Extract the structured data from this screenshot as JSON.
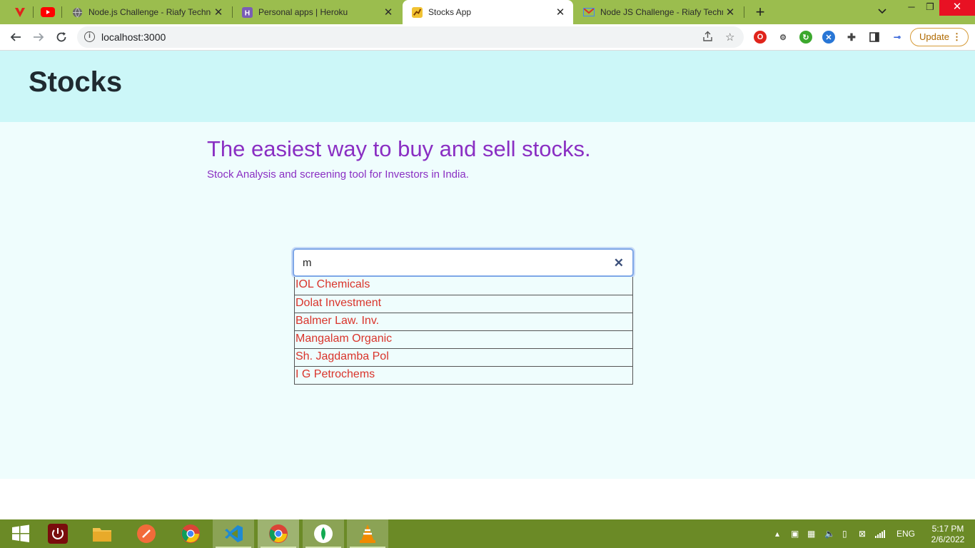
{
  "browser": {
    "tabs": [
      {
        "title": "Node.js Challenge - Riafy Techno",
        "icon": "globe-icon"
      },
      {
        "title": "Personal apps | Heroku",
        "icon": "heroku-icon"
      },
      {
        "title": "Stocks App",
        "icon": "stocks-app-icon",
        "active": true
      },
      {
        "title": "Node JS Challenge - Riafy Techno",
        "icon": "gmail-icon"
      }
    ],
    "url": "localhost:3000",
    "update_label": "Update"
  },
  "app": {
    "title": "Stocks",
    "tagline": "The easiest way to buy and sell stocks.",
    "subtitle": "Stock Analysis and screening tool for Investors in India.",
    "search": {
      "value": "m",
      "clear_glyph": "✕"
    },
    "results": [
      "IOL Chemicals",
      "Dolat Investment",
      "Balmer Law. Inv.",
      "Mangalam Organic",
      "Sh. Jagdamba Pol",
      "I G Petrochems"
    ],
    "colors": {
      "header_bg": "#ccf7f8",
      "main_bg": "#effdfd",
      "accent": "#8a2fc3",
      "result_text": "#d9342b"
    }
  },
  "taskbar": {
    "language": "ENG",
    "time": "5:17 PM",
    "date": "2/6/2022"
  }
}
